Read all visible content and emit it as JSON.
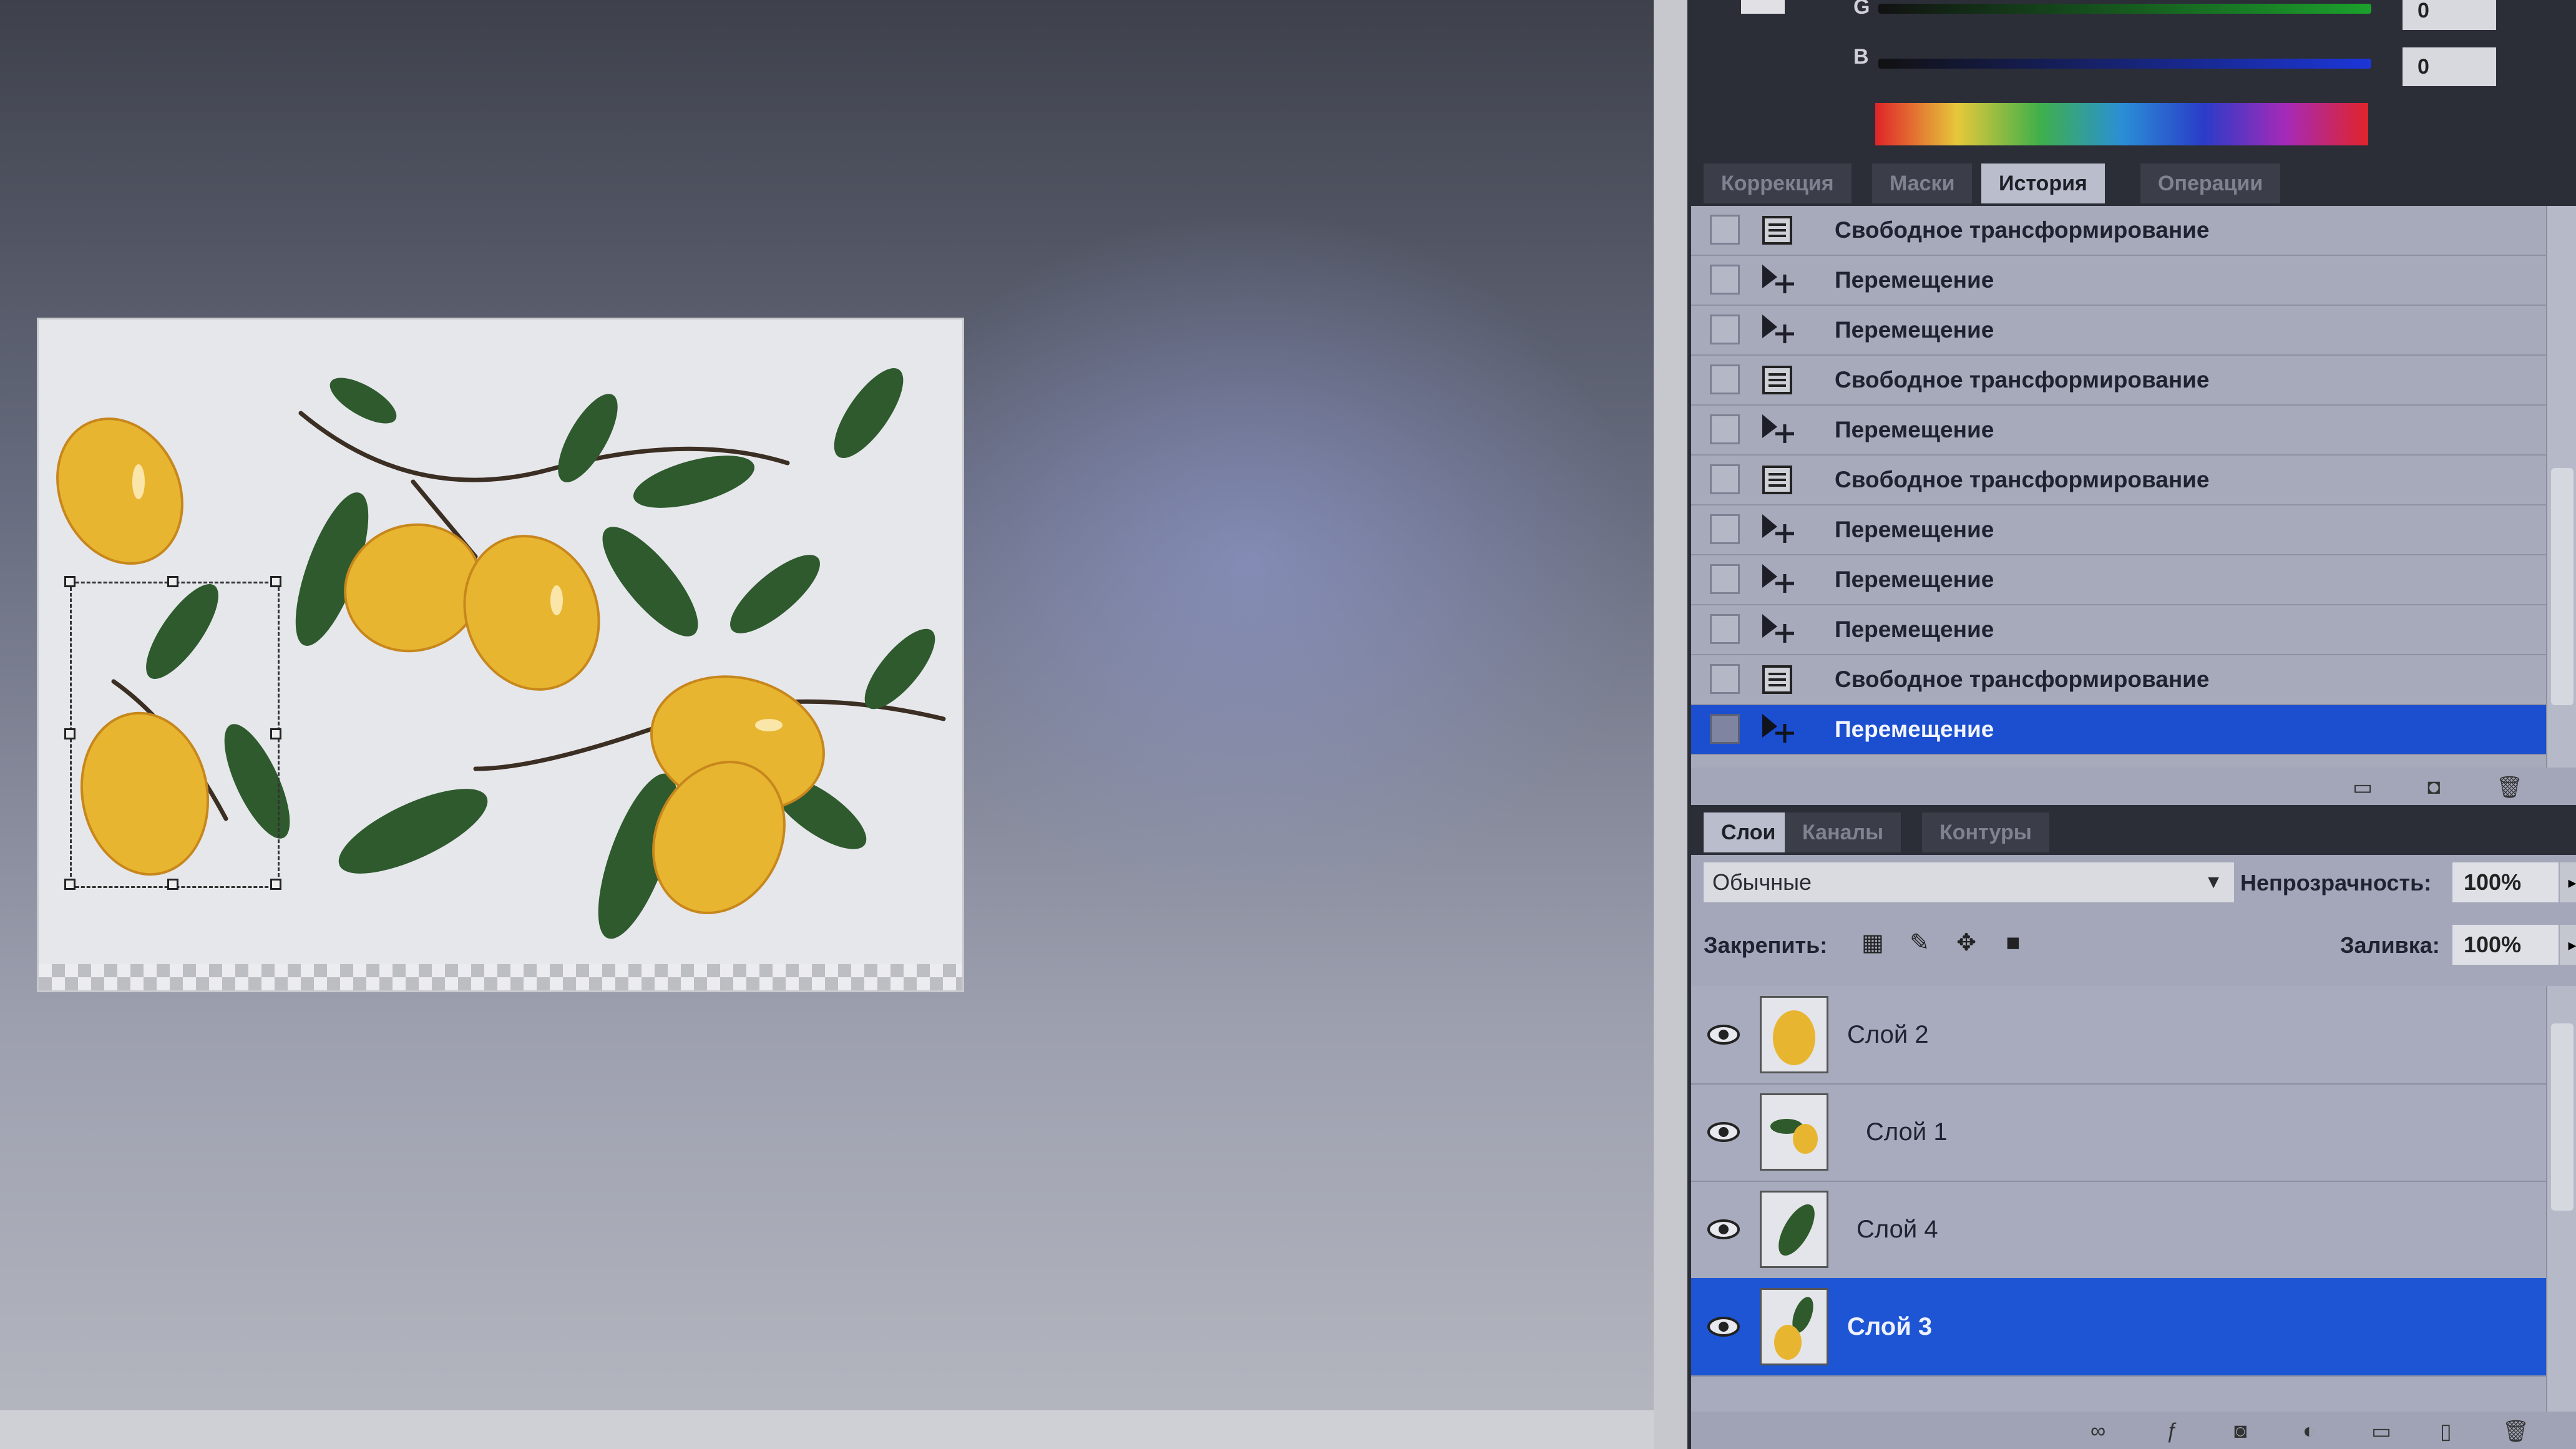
{
  "color_panel": {
    "g_label": "G",
    "b_label": "B",
    "g_value": "0",
    "b_value": "0"
  },
  "history_tabs": [
    "Коррекция",
    "Маски",
    "История",
    "Операции"
  ],
  "history_active_tab": "История",
  "history": [
    {
      "label": "Свободное трансформирование",
      "icon": "transform-icon"
    },
    {
      "label": "Перемещение",
      "icon": "move-icon"
    },
    {
      "label": "Перемещение",
      "icon": "move-icon"
    },
    {
      "label": "Свободное трансформирование",
      "icon": "transform-icon"
    },
    {
      "label": "Перемещение",
      "icon": "move-icon"
    },
    {
      "label": "Свободное трансформирование",
      "icon": "transform-icon"
    },
    {
      "label": "Перемещение",
      "icon": "move-icon"
    },
    {
      "label": "Перемещение",
      "icon": "move-icon"
    },
    {
      "label": "Перемещение",
      "icon": "move-icon"
    },
    {
      "label": "Свободное трансформирование",
      "icon": "transform-icon"
    },
    {
      "label": "Перемещение",
      "icon": "move-icon",
      "selected": true
    }
  ],
  "layers_tabs": [
    "Слои",
    "Каналы",
    "Контуры"
  ],
  "layers_options": {
    "blend_mode": "Обычные",
    "opacity_label": "Непрозрачность:",
    "opacity_value": "100%",
    "lock_label": "Закрепить:",
    "fill_label": "Заливка:",
    "fill_value": "100%"
  },
  "layers": [
    {
      "name": "Слой 2",
      "visible": true,
      "selected": false
    },
    {
      "name": "Слой 1",
      "visible": true,
      "selected": false
    },
    {
      "name": "Слой 4",
      "visible": true,
      "selected": false
    },
    {
      "name": "Слой 3",
      "visible": true,
      "selected": true
    }
  ],
  "colors": {
    "selection_blue": "#1b4fd0",
    "lemon": "#e8b531",
    "leaf": "#2f5a2c"
  }
}
